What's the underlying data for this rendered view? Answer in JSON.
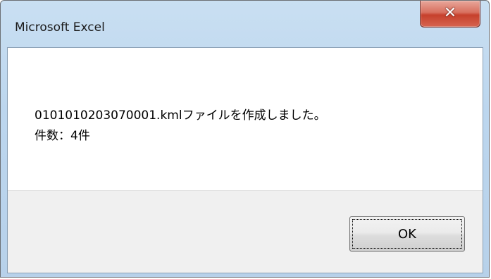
{
  "window": {
    "title": "Microsoft Excel",
    "close_icon": "x-close-icon"
  },
  "message": {
    "line1": "0101010203070001.kmlファイルを作成しました。",
    "line2": "件数：4件"
  },
  "buttons": {
    "ok_label": "OK"
  },
  "colors": {
    "titlebar": "#bcd6ee",
    "close_button": "#c6402c",
    "button_area": "#f0f0f0"
  }
}
